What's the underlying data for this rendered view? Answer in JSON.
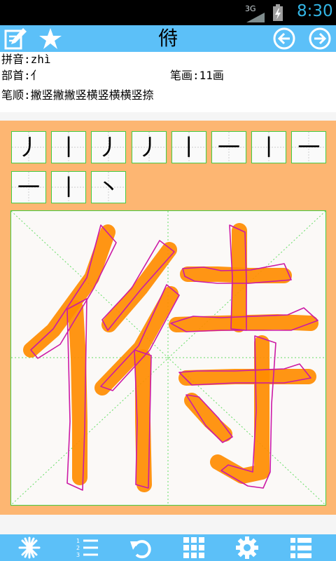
{
  "status_bar": {
    "network": "3G",
    "time": "8:30"
  },
  "title_bar": {
    "title": "偫",
    "left_icons": [
      "edit-note-icon",
      "star-icon"
    ],
    "right_icons": [
      "arrow-left-circle-icon",
      "arrow-right-circle-icon"
    ]
  },
  "info": {
    "pinyin_label": "拼音:",
    "pinyin": "zhì",
    "radical_label": "部首:",
    "radical": "亻",
    "strokes_label": "笔画:",
    "strokes": "11画",
    "order_label": "笔顺:",
    "order": "撇竖撇撇竖横竖横横竖捺"
  },
  "stroke_order": {
    "cells": [
      "丿",
      "丨",
      "丿",
      "丿",
      "丨",
      "一",
      "丨",
      "一",
      "一",
      "丨",
      "丶"
    ]
  },
  "bottom_bar": {
    "icons": [
      "starburst-icon",
      "numbered-list-icon",
      "undo-icon",
      "grid-icon",
      "settings-icon",
      "list-icon"
    ]
  },
  "colors": {
    "accent_bar": "#5cc0f8",
    "panel": "#fdb672",
    "brush": "#ff8c00",
    "outline": "#cc1aa5",
    "grid": "#44cc44",
    "clock": "#33b5e5"
  }
}
